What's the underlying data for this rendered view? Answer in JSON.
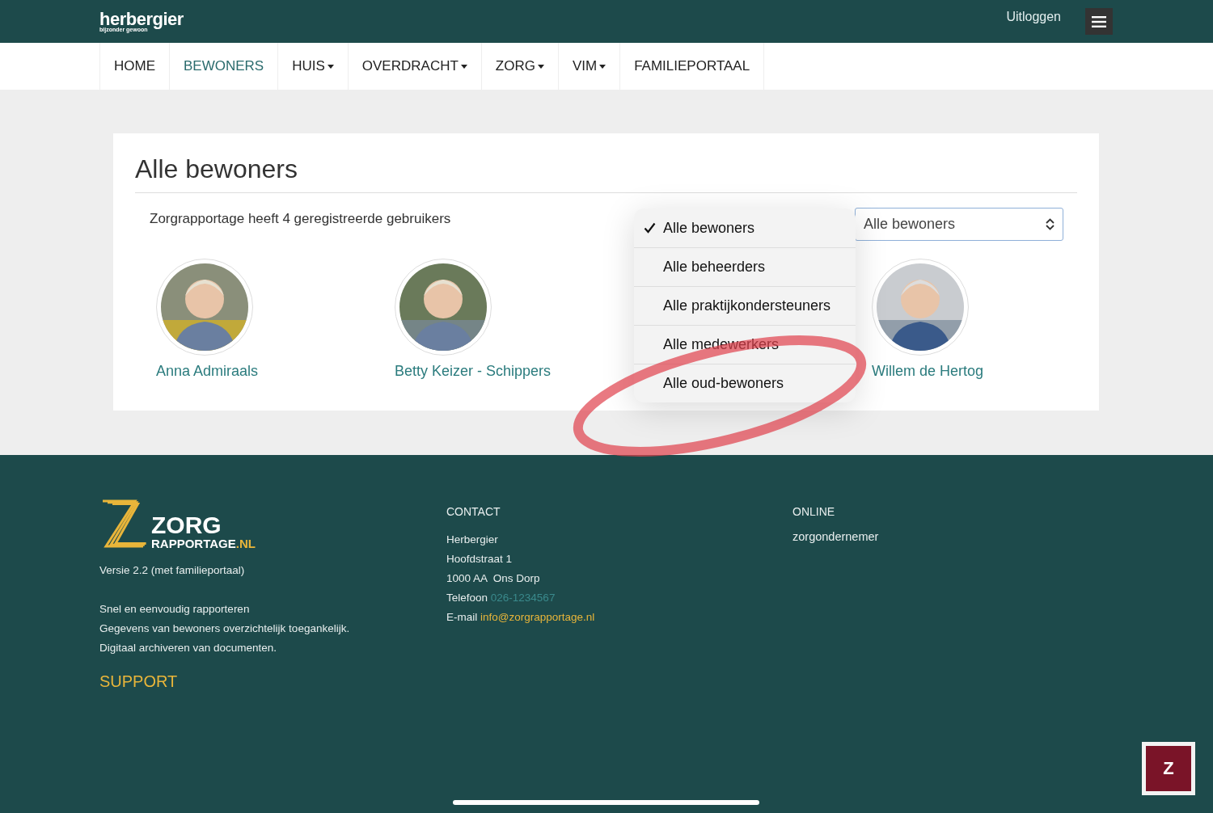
{
  "header": {
    "logo": {
      "name": "herbergier",
      "tagline": "bijzonder gewoon"
    },
    "logout": "Uitloggen"
  },
  "nav": [
    {
      "label": "HOME",
      "selected": false,
      "has_dropdown": false
    },
    {
      "label": "BEWONERS",
      "selected": true,
      "has_dropdown": false
    },
    {
      "label": "HUIS",
      "selected": false,
      "has_dropdown": true
    },
    {
      "label": "OVERDRACHT",
      "selected": false,
      "has_dropdown": true
    },
    {
      "label": "ZORG",
      "selected": false,
      "has_dropdown": true
    },
    {
      "label": "VIM",
      "selected": false,
      "has_dropdown": true
    },
    {
      "label": "FAMILIEPORTAAL",
      "selected": false,
      "has_dropdown": false
    }
  ],
  "card": {
    "title": "Alle bewoners",
    "subtitle": "Zorgrapportage heeft 4 geregistreerde gebruikers",
    "filter": {
      "value": "Alle bewoners",
      "expanded": true,
      "options": [
        {
          "label": "Alle bewoners",
          "selected": true
        },
        {
          "label": "Alle beheerders",
          "selected": false
        },
        {
          "label": "Alle praktijkondersteuners",
          "selected": false
        },
        {
          "label": "Alle medewerkers",
          "selected": false
        },
        {
          "label": "Alle oud-bewoners",
          "selected": false
        }
      ]
    },
    "residents": [
      {
        "name": "Anna Admiraals"
      },
      {
        "name": "Betty Keizer - Schippers"
      },
      {
        "name": "Willem de Hertog"
      }
    ]
  },
  "footer": {
    "logo": {
      "line1": "ZORG",
      "line2": "RAPPORTAGE",
      "suffix": ".NL"
    },
    "version": "Versie 2.2 (met familieportaal)",
    "features": [
      "Snel en eenvoudig rapporteren",
      "Gegevens van bewoners overzichtelijk toegankelijk.",
      "Digitaal archiveren van documenten."
    ],
    "support": "SUPPORT",
    "contact": {
      "heading": "CONTACT",
      "lines": [
        "Herbergier",
        "Hoofdstraat 1",
        "1000 AA  Ons Dorp"
      ],
      "phone_label": "Telefoon",
      "phone": "026-1234567",
      "email_label": "E-mail",
      "email": "info@zorgrapportage.nl"
    },
    "online": {
      "heading": "ONLINE",
      "links": [
        "zorgondernemer"
      ]
    }
  },
  "chat_button": "Z"
}
